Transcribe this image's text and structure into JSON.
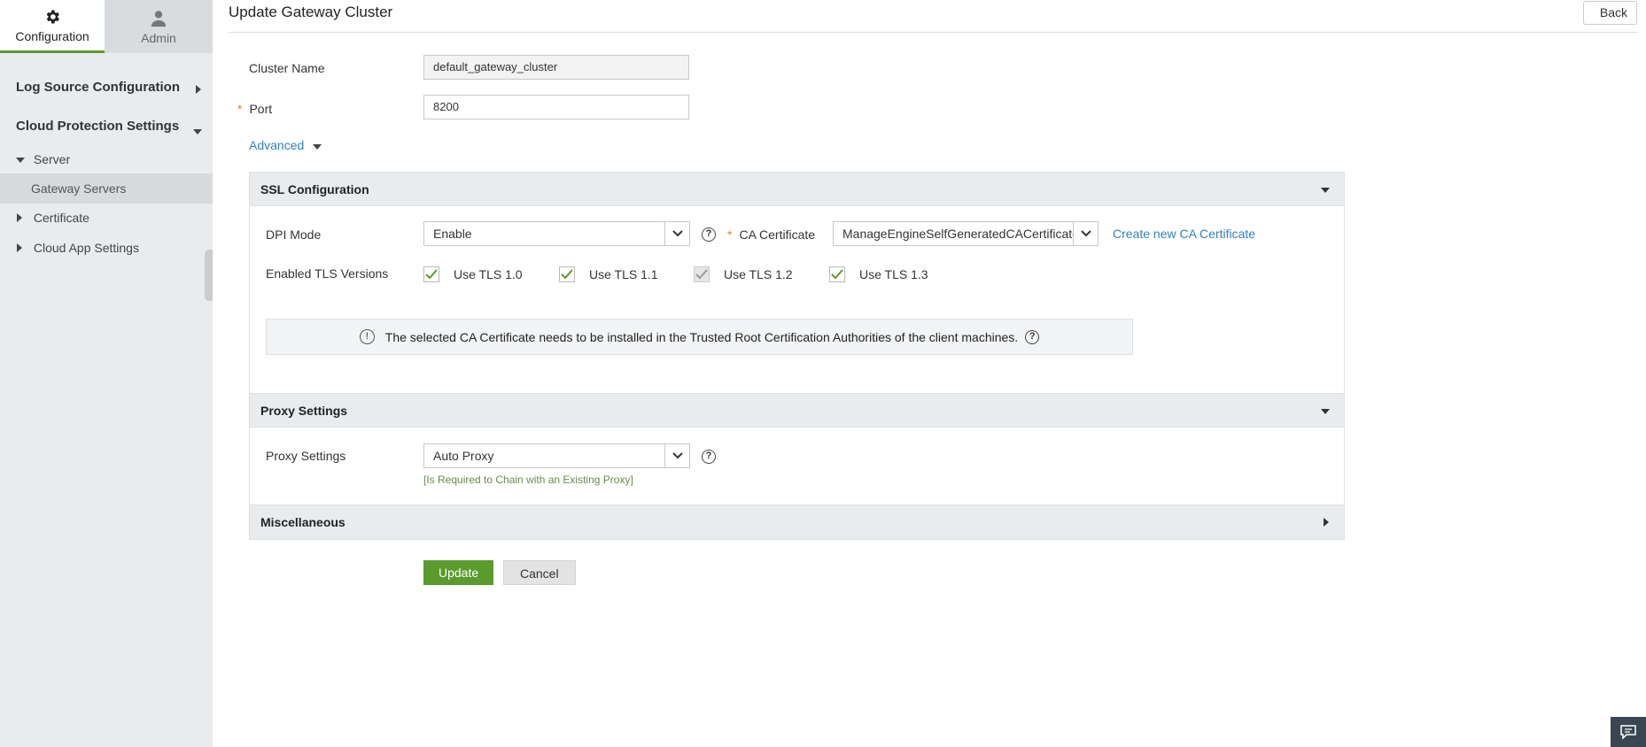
{
  "sidebar": {
    "tabs": [
      {
        "label": "Configuration",
        "icon": "gear-icon",
        "active": true
      },
      {
        "label": "Admin",
        "icon": "user-icon",
        "active": false
      }
    ],
    "log_source": "Log Source Configuration",
    "cloud_protection": "Cloud Protection Settings",
    "server": "Server",
    "gateway_servers": "Gateway Servers",
    "certificate": "Certificate",
    "cloud_app_settings": "Cloud App Settings"
  },
  "header": {
    "title": "Update Gateway Cluster",
    "back_label": "Back"
  },
  "form": {
    "cluster_name_label": "Cluster Name",
    "cluster_name_value": "default_gateway_cluster",
    "port_required": "*",
    "port_label": "Port",
    "port_value": "8200",
    "advanced_label": "Advanced"
  },
  "ssl": {
    "title": "SSL Configuration",
    "dpi_label": "DPI Mode",
    "dpi_value": "Enable",
    "ca_required": "*",
    "ca_label": "CA Certificate",
    "ca_value": "ManageEngineSelfGeneratedCACertificate",
    "create_ca_link": "Create new CA Certificate",
    "tls_label": "Enabled TLS Versions",
    "tls": [
      {
        "label": "Use TLS 1.0",
        "checked": true,
        "disabled": false
      },
      {
        "label": "Use TLS 1.1",
        "checked": true,
        "disabled": false
      },
      {
        "label": "Use TLS 1.2",
        "checked": true,
        "disabled": true
      },
      {
        "label": "Use TLS 1.3",
        "checked": true,
        "disabled": false
      }
    ],
    "info_text": "The selected CA Certificate needs to be installed in the Trusted Root Certification Authorities of the client machines."
  },
  "proxy": {
    "title": "Proxy Settings",
    "label": "Proxy Settings",
    "value": "Auto Proxy",
    "hint": "[Is Required to Chain with an Existing Proxy]"
  },
  "misc": {
    "title": "Miscellaneous"
  },
  "actions": {
    "update_label": "Update",
    "cancel_label": "Cancel"
  },
  "colors": {
    "accent_green": "#5b9b2e",
    "link_blue": "#2f80c4",
    "required_orange": "#d08a1d"
  }
}
